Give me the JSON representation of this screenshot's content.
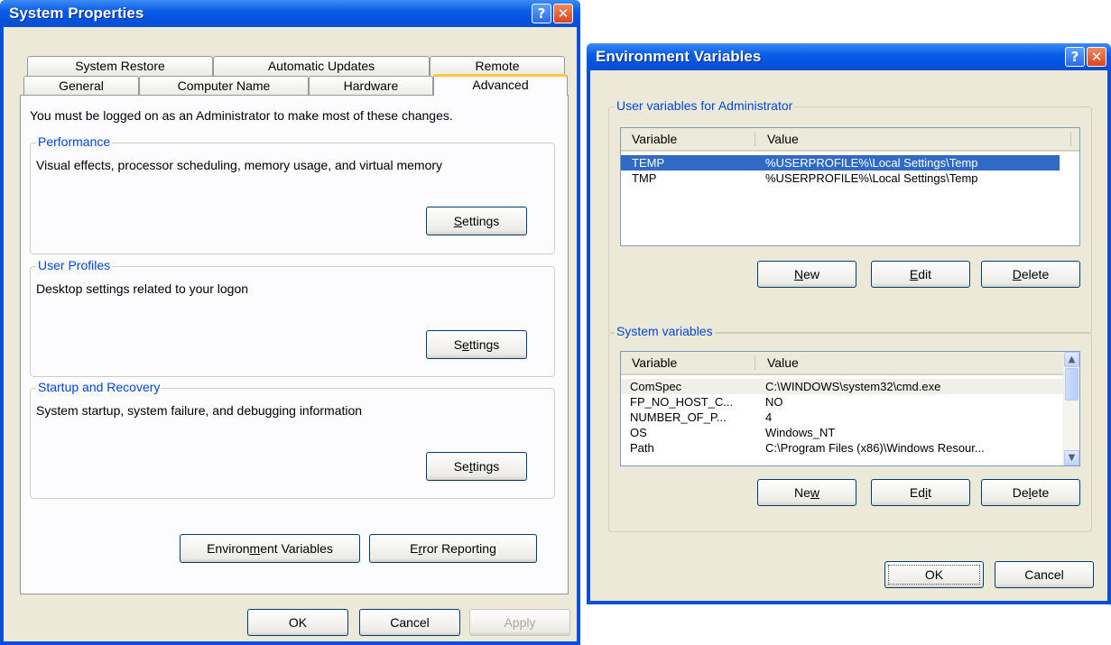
{
  "system_properties": {
    "title": "System Properties",
    "tabs_row1": [
      "System Restore",
      "Automatic Updates",
      "Remote"
    ],
    "tabs_row2": [
      "General",
      "Computer Name",
      "Hardware",
      "Advanced"
    ],
    "admin_note": "You must be logged on as an Administrator to make most of these changes.",
    "performance": {
      "label": "Performance",
      "description": "Visual effects, processor scheduling, memory usage, and virtual memory",
      "button": "Settings"
    },
    "user_profiles": {
      "label": "User Profiles",
      "description": "Desktop settings related to your logon",
      "button": "Settings"
    },
    "startup_recovery": {
      "label": "Startup and Recovery",
      "description": "System startup, system failure, and debugging information",
      "button": "Settings"
    },
    "env_vars_button": "Environment Variables",
    "error_reporting_button": "Error Reporting",
    "ok": "OK",
    "cancel": "Cancel",
    "apply": "Apply"
  },
  "environment_variables": {
    "title": "Environment Variables",
    "user_group_label": "User variables for Administrator",
    "columns": [
      "Variable",
      "Value"
    ],
    "user_vars": [
      {
        "name": "TEMP",
        "value": "%USERPROFILE%\\Local Settings\\Temp",
        "selected": true
      },
      {
        "name": "TMP",
        "value": "%USERPROFILE%\\Local Settings\\Temp",
        "selected": false
      }
    ],
    "user_buttons": {
      "new": "New",
      "edit": "Edit",
      "delete": "Delete"
    },
    "system_group_label": "System variables",
    "system_vars": [
      {
        "name": "ComSpec",
        "value": "C:\\WINDOWS\\system32\\cmd.exe"
      },
      {
        "name": "FP_NO_HOST_C...",
        "value": "NO"
      },
      {
        "name": "NUMBER_OF_P...",
        "value": "4"
      },
      {
        "name": "OS",
        "value": "Windows_NT"
      },
      {
        "name": "Path",
        "value": "C:\\Program Files (x86)\\Windows Resour..."
      }
    ],
    "system_buttons": {
      "new": "New",
      "edit": "Edit",
      "delete": "Delete"
    },
    "ok": "OK",
    "cancel": "Cancel"
  },
  "colors": {
    "title_bar": "#0a5ee6",
    "dialog_face": "#ece9d8",
    "selection": "#316ac5",
    "group_label": "#0046d5",
    "active_tab_accent": "#ffc83c"
  }
}
